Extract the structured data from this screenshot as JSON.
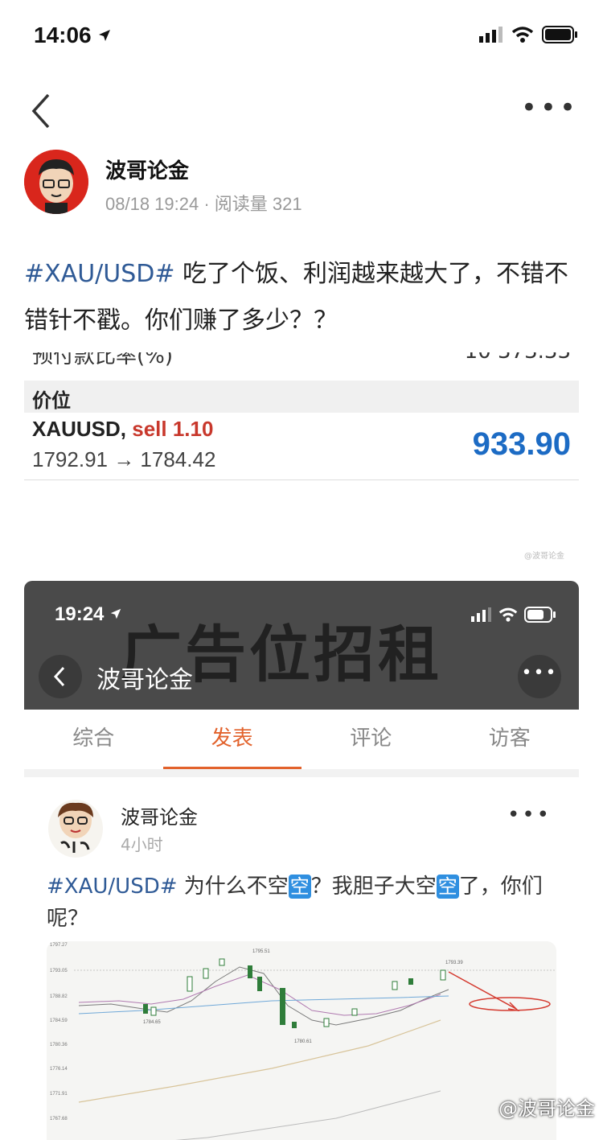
{
  "status_bar": {
    "time": "14:06"
  },
  "author": {
    "name": "波哥论金",
    "meta": "08/18 19:24 · 阅读量 321"
  },
  "post": {
    "hashtag": "#XAU/USD#",
    "text": " 吃了个饭、利润越来越大了，不错不错针不戳。你们赚了多少？？"
  },
  "trade_card": {
    "cut_left": "预付款比率(%)",
    "cut_right": "10 373.33",
    "header": "价位",
    "symbol": "XAUUSD,",
    "side": "sell 1.10",
    "range": "1792.91 → 1784.42",
    "profit": "933.90",
    "small_watermark": "@波哥论金"
  },
  "embedded": {
    "time": "19:24",
    "ad_text": "广告位招租",
    "title": "波哥论金",
    "more": "•••",
    "tabs": [
      "综合",
      "发表",
      "评论",
      "访客"
    ],
    "active_tab": 1,
    "post": {
      "author": "波哥论金",
      "time": "4小时",
      "hashtag": "#XAU/USD#",
      "t1": " 为什么不空",
      "kong": "空",
      "t2": "？我胆子大空",
      "t3": "了，你们呢？"
    },
    "chart": {
      "y_ticks": [
        "1797.27",
        "1793.05",
        "1788.82",
        "1784.59",
        "1780.36",
        "1776.14",
        "1771.91",
        "1767.68"
      ],
      "label_high": "1795.51",
      "label_low": "1780.61",
      "label_left_low": "1784.65",
      "label_last": "1793.39"
    }
  },
  "watermark": "@波哥论金",
  "colors": {
    "hashtag": "#2f5a96",
    "accent": "#e2622c",
    "profit": "#1c6bc4",
    "sell": "#c8382c"
  }
}
